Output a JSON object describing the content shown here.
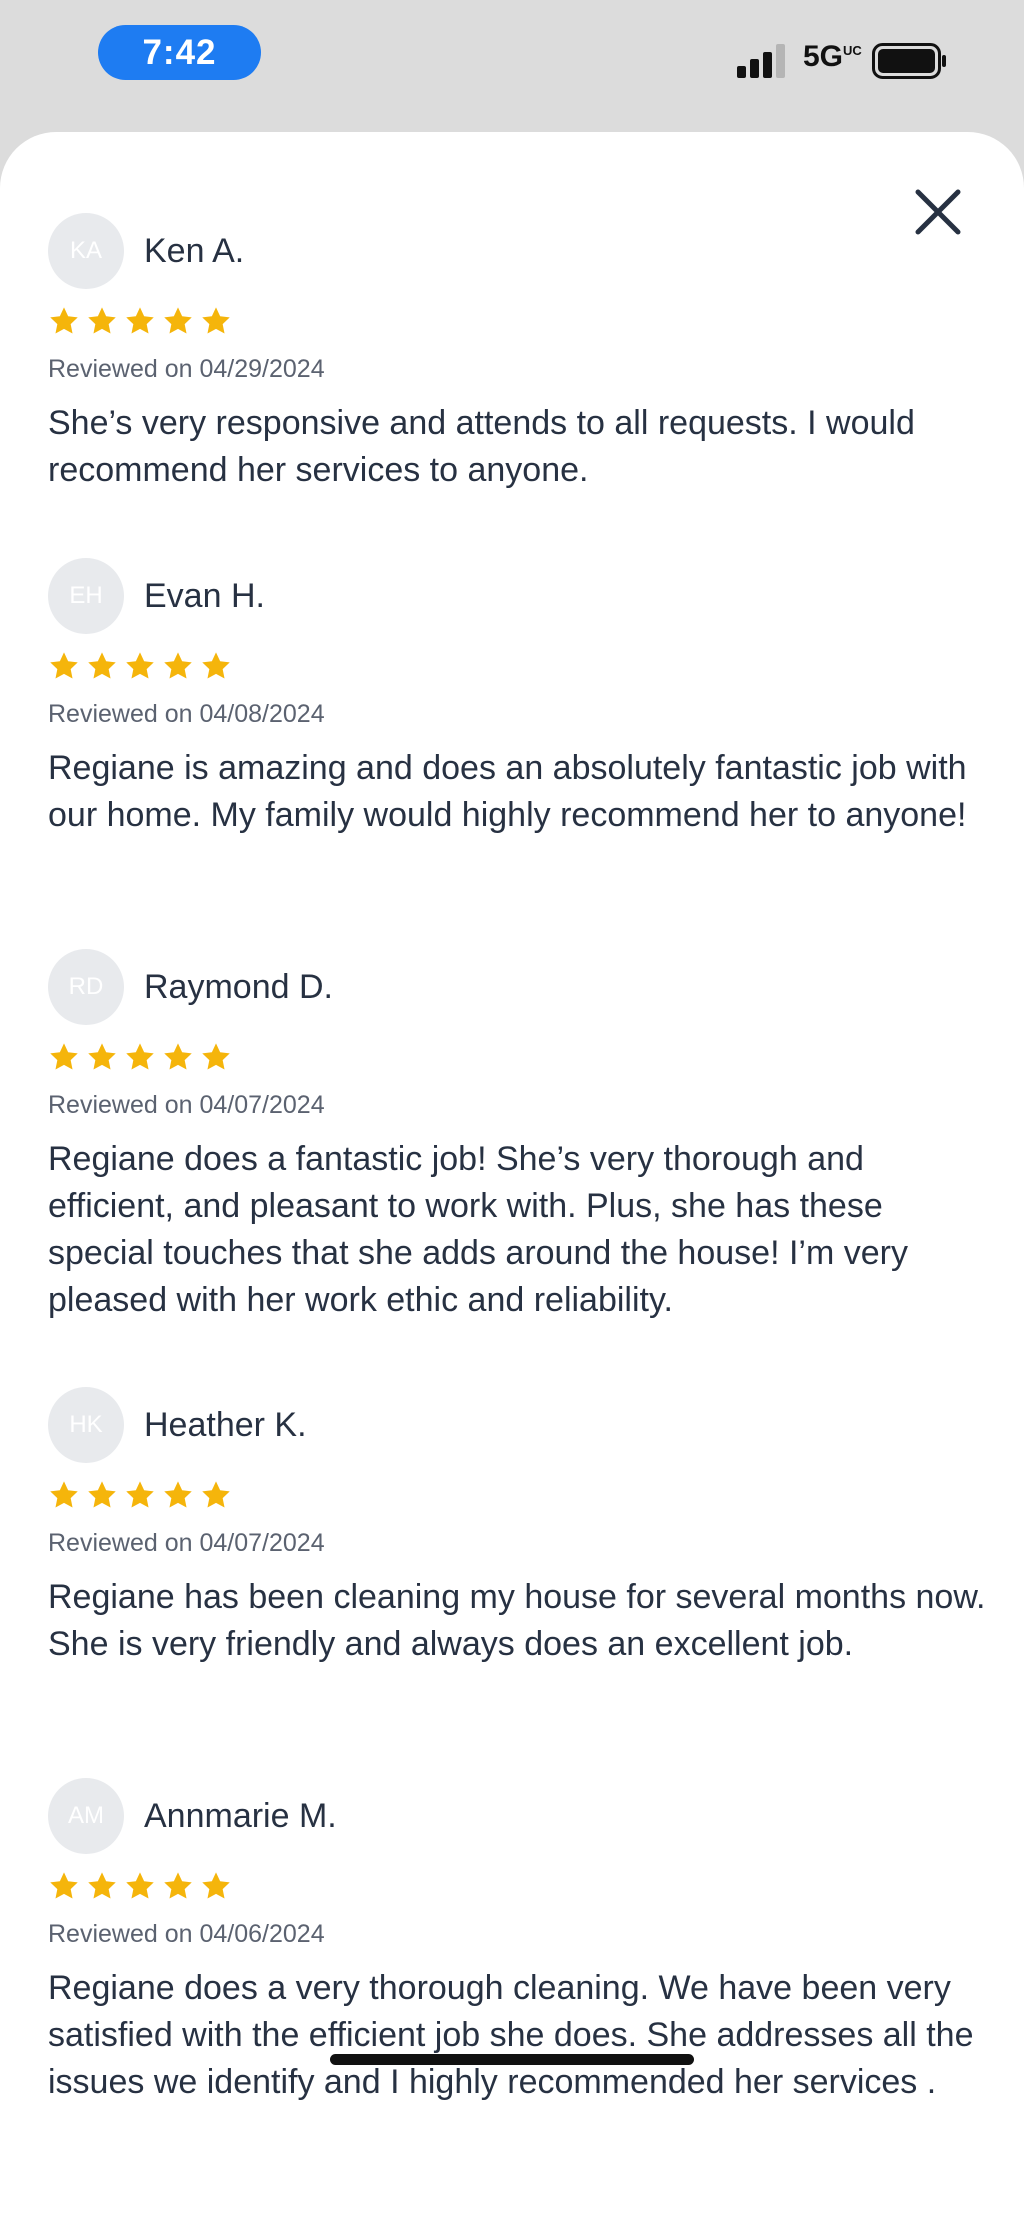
{
  "status_bar": {
    "time": "7:42",
    "network": "5G",
    "network_suffix": "UC"
  },
  "colors": {
    "star": "#f5b50b",
    "accent": "#1e7cf2",
    "avatar_bg": "#e8eaed"
  },
  "icons": [
    "signal-icon",
    "battery-icon",
    "close-icon",
    "star-icon"
  ],
  "reviews": [
    {
      "initials": "KA",
      "name": "Ken A.",
      "rating": 5,
      "date": "Reviewed on 04/29/2024",
      "text": "She’s very responsive and attends to all requests. I would recommend her services to anyone."
    },
    {
      "initials": "EH",
      "name": "Evan H.",
      "rating": 5,
      "date": "Reviewed on 04/08/2024",
      "text": "Regiane is amazing and does an absolutely fantastic job with our home. My family would highly recommend her to anyone!"
    },
    {
      "initials": "RD",
      "name": "Raymond D.",
      "rating": 5,
      "date": "Reviewed on 04/07/2024",
      "text": "Regiane does a fantastic job! She’s very thorough and efficient, and pleasant to work with. Plus, she has these special touches that she adds around the house! I’m very pleased with her work ethic and reliability."
    },
    {
      "initials": "HK",
      "name": "Heather K.",
      "rating": 5,
      "date": "Reviewed on 04/07/2024",
      "text": "Regiane has been cleaning my house for several months now.  She is very friendly and always does an excellent job."
    },
    {
      "initials": "AM",
      "name": "Annmarie M.",
      "rating": 5,
      "date": "Reviewed on 04/06/2024",
      "text": "Regiane does a very thorough cleaning.  We have been very satisfied with the efficient job she does.  She addresses all the issues we identify and I highly recommended her services ."
    }
  ]
}
